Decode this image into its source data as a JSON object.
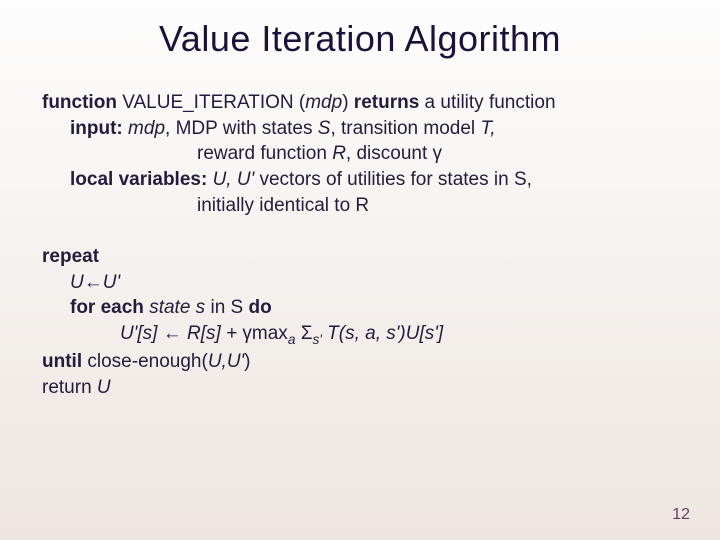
{
  "title": "Value Iteration Algorithm",
  "algo": {
    "kw_function": "function",
    "fname": "VALUE_ITERATION (",
    "arg": "mdp",
    "fclose": ")",
    "kw_returns": " returns ",
    "returns_desc": "a utility function",
    "kw_input": "input:",
    "input_arg": " mdp",
    "input_tail1": ", MDP with states ",
    "S": "S",
    "input_tail2": ", transition model ",
    "T": "T,",
    "reward_line_a": "reward function ",
    "R": "R",
    "reward_line_b": ", discount ",
    "gamma": "γ",
    "kw_local": "local variables:",
    "UU": " U, U'",
    "local_tail1": "  vectors of utilities for states in S,",
    "local_tail2": "initially identical to R",
    "kw_repeat": "repeat",
    "assign1a": "U",
    "assign1arrow": "←",
    "assign1b": "U'",
    "kw_foreach": "for each ",
    "state_s": "state s",
    "foreach_tail": " in S ",
    "kw_do": "do",
    "update_lhs": "U'[s] ",
    "update_arrow": "← ",
    "update_rhs1": "R[s] + ",
    "update_gamma": "γ",
    "update_max": "max",
    "update_sub_a": "a",
    "update_sigma": " Σ",
    "update_sub_s": "s'",
    "update_T": " T(s, a, s')U[s']",
    "kw_until": "until",
    "until_cond": " close-enough(",
    "until_args": "U,U'",
    "until_close": ")",
    "return_kw": "return ",
    "return_val": "U"
  },
  "page_number": "12"
}
